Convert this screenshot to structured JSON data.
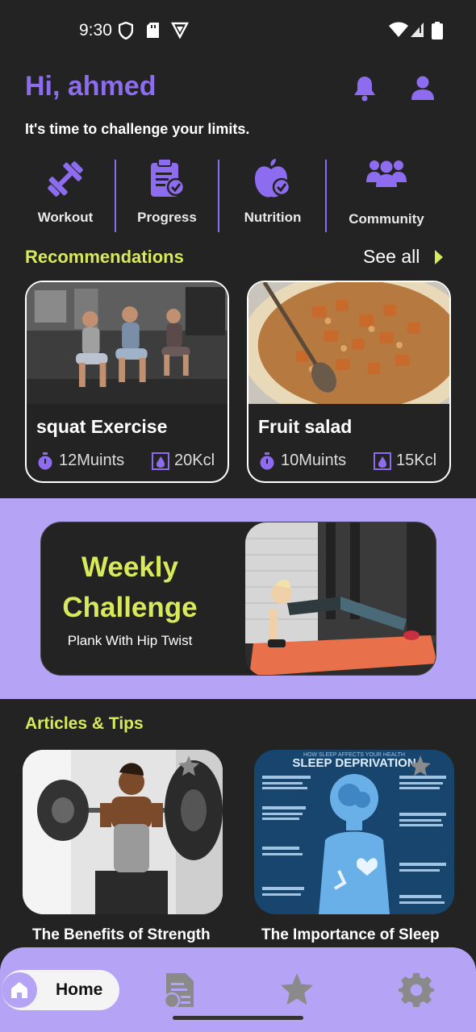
{
  "status": {
    "time": "9:30"
  },
  "header": {
    "greeting": "Hi, ahmed",
    "subtitle": "It's time to challenge your limits."
  },
  "categories": [
    {
      "label": "Workout",
      "icon": "dumbbell-icon"
    },
    {
      "label": "Progress",
      "icon": "clipboard-check-icon"
    },
    {
      "label": "Nutrition",
      "icon": "apple-icon"
    },
    {
      "label": "Community",
      "icon": "users-icon"
    }
  ],
  "recommendations": {
    "title": "Recommendations",
    "see_all": "See all",
    "items": [
      {
        "title": "squat Exercise",
        "time": "12Muints",
        "kcal": "20Kcl"
      },
      {
        "title": "Fruit salad",
        "time": "10Muints",
        "kcal": "15Kcl"
      }
    ]
  },
  "challenge": {
    "line1": "Weekly",
    "line2": "Challenge",
    "subtitle": "Plank With Hip Twist"
  },
  "articles": {
    "title": "Articles & Tips",
    "items": [
      {
        "title": "The Benefits of Strength"
      },
      {
        "title": "The Importance of Sleep",
        "image_text": "SLEEP DEPRIVATION",
        "image_caption": "HOW SLEEP AFFECTS YOUR HEALTH"
      }
    ]
  },
  "nav": {
    "home_label": "Home"
  },
  "colors": {
    "accent": "#8E6CF0",
    "highlight": "#D8EA5A",
    "lavender": "#B5A3F5",
    "background": "#232323"
  }
}
